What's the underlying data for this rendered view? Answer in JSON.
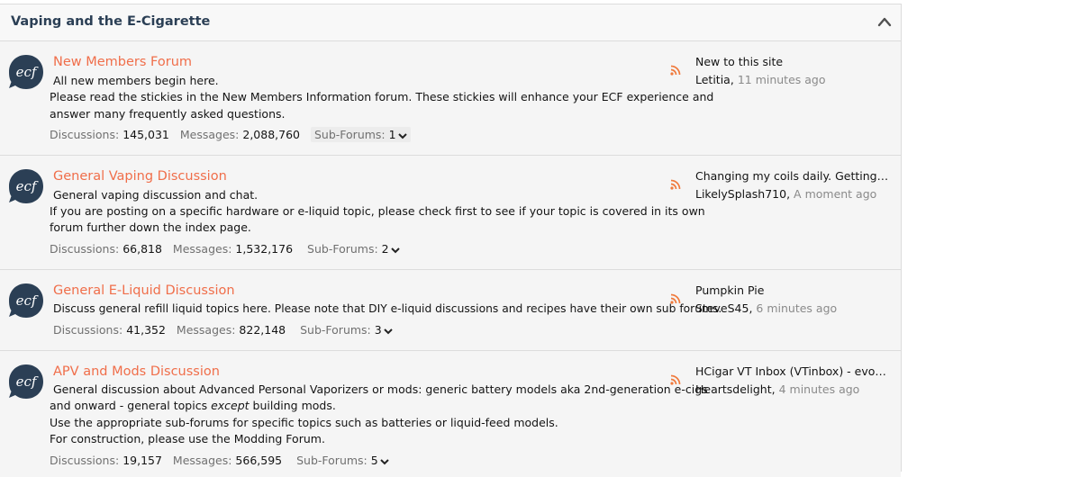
{
  "category": {
    "title": "Vaping and the E-Cigarette"
  },
  "icon_text": "ecf",
  "colors": {
    "accent": "#f06e4a",
    "icon_bg": "#2b3f55",
    "title": "#2b3f55"
  },
  "labels": {
    "discussions": "Discussions:",
    "messages": "Messages:",
    "subforums": "Sub-Forums:"
  },
  "forums": [
    {
      "title": "New Members Forum",
      "desc": [
        "All new members begin here.",
        " Please read the stickies in the New Members Information forum. These stickies will enhance your ECF experience and",
        "answer many frequently asked questions."
      ],
      "discussions": "145,031",
      "messages": "2,088,760",
      "subforums": "1",
      "last_title": "New to this site",
      "last_user": "Letitia,",
      "last_time": "11 minutes ago"
    },
    {
      "title": "General Vaping Discussion",
      "desc": [
        "General vaping discussion and chat.",
        " If you are posting on a specific hardware or e-liquid topic, please check first to see if your topic is covered in its own",
        "forum further down the index page."
      ],
      "discussions": "66,818",
      "messages": "1,532,176",
      "subforums": "2",
      "last_title": "Changing my coils daily. Getting fru...",
      "last_user": "LikelySplash710,",
      "last_time": "A moment ago"
    },
    {
      "title": "General E-Liquid Discussion",
      "desc": [
        "Discuss general refill liquid topics here. Please note that DIY e-liquid discussions and recipes have their own sub forums."
      ],
      "discussions": "41,352",
      "messages": "822,148",
      "subforums": "3",
      "last_title": "Pumpkin Pie",
      "last_user": "SteveS45,",
      "last_time": "6 minutes ago"
    },
    {
      "title": "APV and Mods Discussion",
      "desc_parts": {
        "line1": "General discussion about Advanced Personal Vaporizers or mods: generic battery models aka 2nd-generation e-cigs",
        "line2_a": " and onward - general topics ",
        "line2_em": "except",
        "line2_b": " building mods.",
        "line3": "Use the appropriate sub-forums for specific topics such as batteries or liquid-feed models.",
        "line4": "For construction, please use the Modding Forum."
      },
      "discussions": "19,157",
      "messages": "566,595",
      "subforums": "5",
      "last_title": "HCigar VT Inbox (VTinbox) - evolv ...",
      "last_user": "Heartsdelight,",
      "last_time": "4 minutes ago"
    }
  ]
}
